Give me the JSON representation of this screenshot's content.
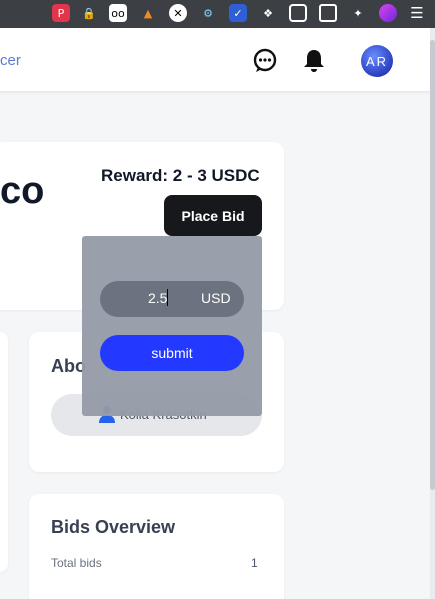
{
  "header": {
    "brand_fragment": "cer",
    "avatar_initials": "AR"
  },
  "task": {
    "title_fragment": "co",
    "reward": "Reward: 2 - 3 USDC",
    "place_bid_label": "Place Bid"
  },
  "bid_popover": {
    "amount_value": "2.5",
    "currency": "USD",
    "submit_label": "submit"
  },
  "about": {
    "title_fragment": "Abo",
    "user_name": "Kolia Krasotkin"
  },
  "bids_overview": {
    "title": "Bids Overview",
    "total_label": "Total bids",
    "total_value": "1"
  },
  "icons": [
    "chat-icon",
    "bell-icon",
    "user-icon"
  ],
  "colors": {
    "submit": "#2339ff",
    "place_bid": "#16181c",
    "popover": "#949ba8"
  }
}
